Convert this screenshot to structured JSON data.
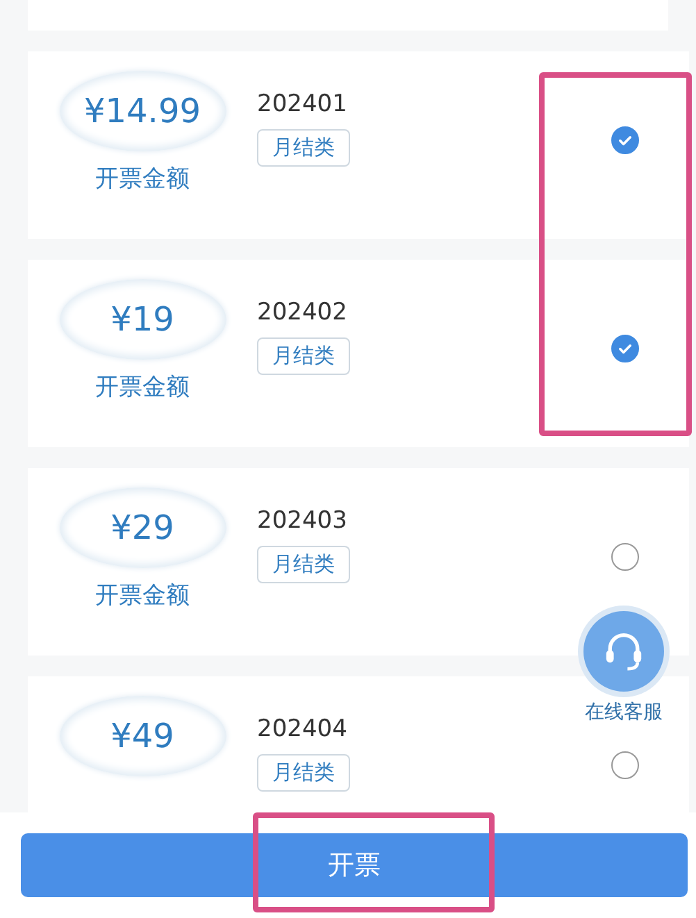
{
  "invoices": [
    {
      "amount": "¥14.99",
      "amount_label": "开票金额",
      "period": "202401",
      "tag": "月结类",
      "selected": true
    },
    {
      "amount": "¥19",
      "amount_label": "开票金额",
      "period": "202402",
      "tag": "月结类",
      "selected": true
    },
    {
      "amount": "¥29",
      "amount_label": "开票金额",
      "period": "202403",
      "tag": "月结类",
      "selected": false
    },
    {
      "amount": "¥49",
      "period": "202404",
      "tag": "月结类",
      "selected": false
    }
  ],
  "support": {
    "label": "在线客服"
  },
  "submit_button": "开票"
}
